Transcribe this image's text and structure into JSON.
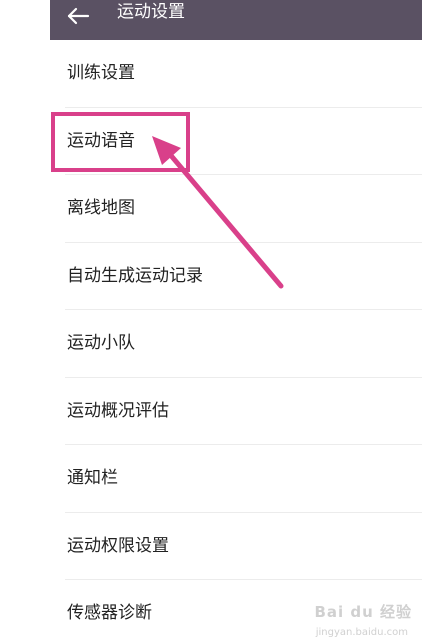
{
  "header": {
    "title": "运动设置",
    "background": "#5a5163"
  },
  "menu": {
    "items": [
      {
        "label": "训练设置"
      },
      {
        "label": "运动语音"
      },
      {
        "label": "离线地图"
      },
      {
        "label": "自动生成运动记录"
      },
      {
        "label": "运动小队"
      },
      {
        "label": "运动概况评估"
      },
      {
        "label": "通知栏"
      },
      {
        "label": "运动权限设置"
      },
      {
        "label": "传感器诊断"
      }
    ]
  },
  "annotation": {
    "color": "#d9408a"
  },
  "watermark": {
    "brand": "Bai du 经验",
    "url": "jingyan.baidu.com"
  }
}
